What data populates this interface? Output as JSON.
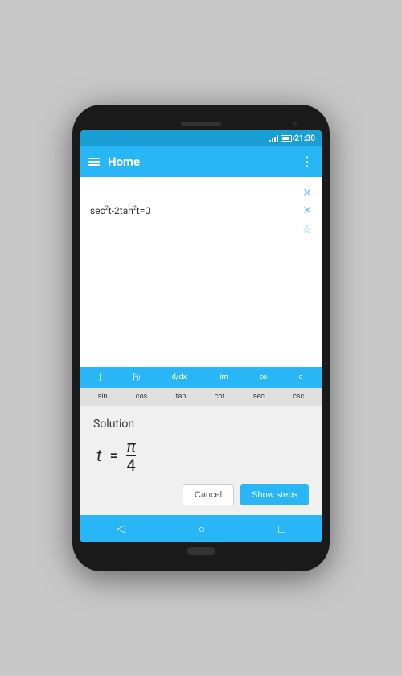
{
  "status_bar": {
    "time": "21:30",
    "signal_alt": "signal bars"
  },
  "app_bar": {
    "title": "Home",
    "menu_icon": "☰",
    "more_icon": "⋮"
  },
  "equations": [
    {
      "text": "",
      "has_close": true,
      "close_icon": "✕"
    },
    {
      "text": "sec²t-2tan²t=0",
      "has_close": true,
      "close_icon": "✕"
    },
    {
      "text": "",
      "has_star": true,
      "star_icon": "☆"
    }
  ],
  "keyboard_toolbar": {
    "items": [
      "∫",
      "∫ᵇₐ",
      "d/dx",
      "lim",
      "∞",
      "e"
    ]
  },
  "keyboard_row": {
    "items": [
      "sin",
      "cos",
      "tan",
      "cot",
      "sec",
      "csc"
    ]
  },
  "solution": {
    "title": "Solution",
    "variable": "t",
    "equals": "=",
    "numerator": "π",
    "denominator": "4",
    "buttons": {
      "cancel": "Cancel",
      "show_steps": "Show steps"
    }
  },
  "nav_bar": {
    "back_icon": "◁",
    "home_icon": "○",
    "recent_icon": "□"
  }
}
